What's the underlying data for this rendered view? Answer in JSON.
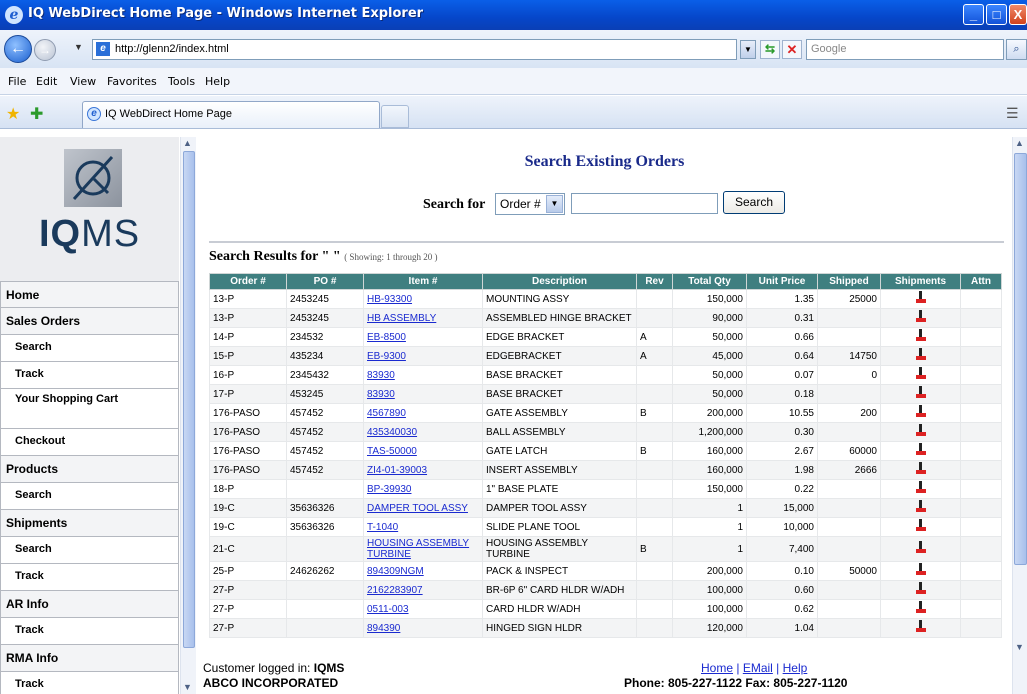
{
  "window": {
    "title": "IQ WebDirect Home Page - Windows Internet Explorer",
    "minimize": "_",
    "maximize": "□",
    "close": "X"
  },
  "browser": {
    "url": "http://glenn2/index.html",
    "search_placeholder": "Google",
    "menu": [
      "File",
      "Edit",
      "View",
      "Favorites",
      "Tools",
      "Help"
    ],
    "tab_label": "IQ WebDirect Home Page"
  },
  "sidebar": {
    "logo_text_a": "IQ",
    "logo_text_b": "MS",
    "items": [
      {
        "label": "Home",
        "sub": false
      },
      {
        "label": "Sales Orders",
        "sub": false
      },
      {
        "label": "Search",
        "sub": true
      },
      {
        "label": "Track",
        "sub": true
      },
      {
        "label": "Your Shopping Cart",
        "sub": true
      },
      {
        "label": "Checkout",
        "sub": true
      },
      {
        "label": "Products",
        "sub": false
      },
      {
        "label": "Search",
        "sub": true
      },
      {
        "label": "Shipments",
        "sub": false
      },
      {
        "label": "Search",
        "sub": true
      },
      {
        "label": "Track",
        "sub": true
      },
      {
        "label": "AR Info",
        "sub": false
      },
      {
        "label": "Track",
        "sub": true
      },
      {
        "label": "RMA Info",
        "sub": false
      },
      {
        "label": "Track",
        "sub": true
      }
    ]
  },
  "main": {
    "title": "Search Existing Orders",
    "search_label": "Search for",
    "search_field": "Order #",
    "search_button": "Search",
    "results_heading": "Search Results for \" \"",
    "results_showing": "( Showing: 1 through 20 )",
    "columns": [
      "Order #",
      "PO #",
      "Item #",
      "Description",
      "Rev",
      "Total Qty",
      "Unit Price",
      "Shipped",
      "Shipments",
      "Attn"
    ],
    "rows": [
      [
        "13-P",
        "2453245",
        "HB-93300",
        "MOUNTING ASSY",
        "",
        "150,000",
        "1.35",
        "25000"
      ],
      [
        "13-P",
        "2453245",
        "HB ASSEMBLY",
        "ASSEMBLED HINGE BRACKET",
        "",
        "90,000",
        "0.31",
        ""
      ],
      [
        "14-P",
        "234532",
        "EB-8500",
        "EDGE BRACKET",
        "A",
        "50,000",
        "0.66",
        ""
      ],
      [
        "15-P",
        "435234",
        "EB-9300",
        "EDGEBRACKET",
        "A",
        "45,000",
        "0.64",
        "14750"
      ],
      [
        "16-P",
        "2345432",
        "83930",
        "BASE BRACKET",
        "",
        "50,000",
        "0.07",
        "0"
      ],
      [
        "17-P",
        "453245",
        "83930",
        "BASE BRACKET",
        "",
        "50,000",
        "0.18",
        ""
      ],
      [
        "176-PASO",
        "457452",
        "4567890",
        "GATE ASSEMBLY",
        "B",
        "200,000",
        "10.55",
        "200"
      ],
      [
        "176-PASO",
        "457452",
        "435340030",
        "BALL ASSEMBLY",
        "",
        "1,200,000",
        "0.30",
        ""
      ],
      [
        "176-PASO",
        "457452",
        "TAS-50000",
        "GATE LATCH",
        "B",
        "160,000",
        "2.67",
        "60000"
      ],
      [
        "176-PASO",
        "457452",
        "ZI4-01-39003",
        "INSERT ASSEMBLY",
        "",
        "160,000",
        "1.98",
        "2666"
      ],
      [
        "18-P",
        "",
        "BP-39930",
        "1\" BASE PLATE",
        "",
        "150,000",
        "0.22",
        ""
      ],
      [
        "19-C",
        "35636326",
        "DAMPER TOOL ASSY",
        "DAMPER TOOL ASSY",
        "",
        "1",
        "15,000",
        ""
      ],
      [
        "19-C",
        "35636326",
        "T-1040",
        "SLIDE PLANE TOOL",
        "",
        "1",
        "10,000",
        ""
      ],
      [
        "21-C",
        "",
        "HOUSING ASSEMBLY TURBINE",
        "HOUSING ASSEMBLY TURBINE",
        "B",
        "1",
        "7,400",
        ""
      ],
      [
        "25-P",
        "24626262",
        "894309NGM",
        "PACK & INSPECT",
        "",
        "200,000",
        "0.10",
        "50000"
      ],
      [
        "27-P",
        "",
        "2162283907",
        "BR-6P 6\" CARD HLDR W/ADH",
        "",
        "100,000",
        "0.60",
        ""
      ],
      [
        "27-P",
        "",
        "0511-003",
        "CARD HLDR W/ADH",
        "",
        "100,000",
        "0.62",
        ""
      ],
      [
        "27-P",
        "",
        "894390",
        "HINGED SIGN HLDR",
        "",
        "120,000",
        "1.04",
        ""
      ]
    ]
  },
  "footer": {
    "logged_in": "Customer logged in: ",
    "user": "IQMS",
    "company": "ABCO INCORPORATED",
    "link_home": "Home",
    "link_email": "EMail",
    "link_help": "Help",
    "separator": " | ",
    "phone": "Phone: 805-227-1122  Fax: 805-227-1120"
  }
}
